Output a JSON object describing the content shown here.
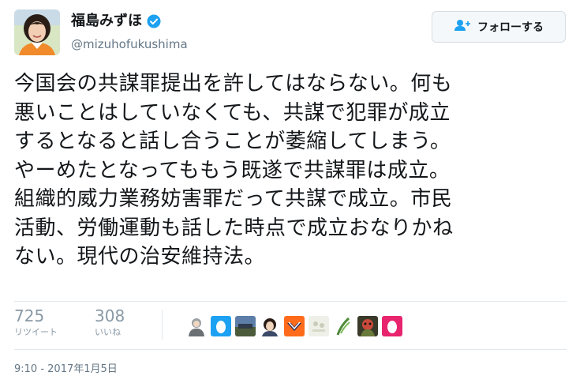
{
  "user": {
    "display_name": "福島みずほ",
    "handle": "@mizuhofukushima"
  },
  "follow_button": {
    "label": "フォローする",
    "icon": "add-user-icon"
  },
  "tweet": {
    "lines": [
      "今国会の共謀罪提出を許してはならない。何も",
      "悪いことはしていなくても、共謀で犯罪が成立",
      "するとなると話し合うことが萎縮してしまう。",
      "やーめたとなってももう既遂で共謀罪は成立。",
      "組織的威力業務妨害罪だって共謀で成立。市民",
      "活動、労働運動も話した時点で成立おなりかね",
      "ない。現代の治安維持法。"
    ]
  },
  "stats": {
    "retweets": {
      "count": "725",
      "label": "リツイート"
    },
    "likes": {
      "count": "308",
      "label": "いいね"
    }
  },
  "likers": [
    "liker-avatar-1",
    "liker-avatar-2",
    "liker-avatar-3",
    "liker-avatar-4",
    "liker-avatar-5",
    "liker-avatar-6",
    "liker-avatar-7",
    "liker-avatar-8",
    "liker-avatar-9"
  ],
  "timestamp": "9:10 - 2017年1月5日",
  "colors": {
    "verified": "#1da1f2",
    "muted_text": "#8899a6",
    "handle": "#657786",
    "divider": "#e1e8ed",
    "follow_icon": "#1da1f2"
  }
}
